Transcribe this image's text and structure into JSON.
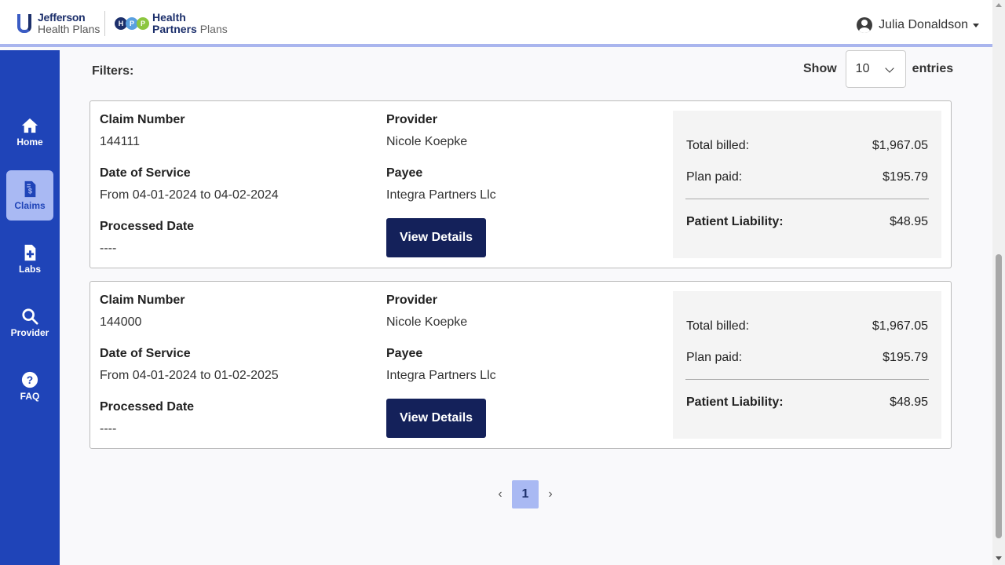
{
  "brand": {
    "jefferson_line1": "Jefferson",
    "jefferson_line2": "Health Plans",
    "hpp_dots": [
      "H",
      "P",
      "P"
    ],
    "hpp_line1": "Health",
    "hpp_line2a": "Partners",
    "hpp_line2b": "Plans"
  },
  "user": {
    "name": "Julia Donaldson"
  },
  "sidebar": {
    "items": [
      {
        "label": "Home",
        "icon": "home-icon"
      },
      {
        "label": "Claims",
        "icon": "claims-icon",
        "active": true
      },
      {
        "label": "Labs",
        "icon": "labs-icon"
      },
      {
        "label": "Provider",
        "icon": "search-icon"
      },
      {
        "label": "FAQ",
        "icon": "help-icon"
      }
    ]
  },
  "filters": {
    "label": "Filters:"
  },
  "entries": {
    "show_label": "Show",
    "value": "10",
    "suffix": "entries"
  },
  "labels": {
    "claim_number": "Claim Number",
    "provider": "Provider",
    "date_of_service": "Date of Service",
    "payee": "Payee",
    "processed_date": "Processed Date",
    "view_details": "View Details",
    "total_billed": "Total billed:",
    "plan_paid": "Plan paid:",
    "patient_liability": "Patient Liability:"
  },
  "claims": [
    {
      "claim_number": "144111",
      "provider": "Nicole Koepke",
      "date_of_service": "From 04-01-2024 to 04-02-2024",
      "payee": "Integra Partners Llc",
      "processed_date": "----",
      "total_billed": "$1,967.05",
      "plan_paid": "$195.79",
      "patient_liability": "$48.95"
    },
    {
      "claim_number": "144000",
      "provider": "Nicole Koepke",
      "date_of_service": "From 04-01-2024 to 01-02-2025",
      "payee": "Integra Partners Llc",
      "processed_date": "----",
      "total_billed": "$1,967.05",
      "plan_paid": "$195.79",
      "patient_liability": "$48.95"
    }
  ],
  "pagination": {
    "prev": "‹",
    "current": "1",
    "next": "›"
  },
  "colors": {
    "sidebar": "#1f44b8",
    "active_nav": "#a9b9f3",
    "button": "#14215a",
    "header_border": "#a9b5ee"
  }
}
